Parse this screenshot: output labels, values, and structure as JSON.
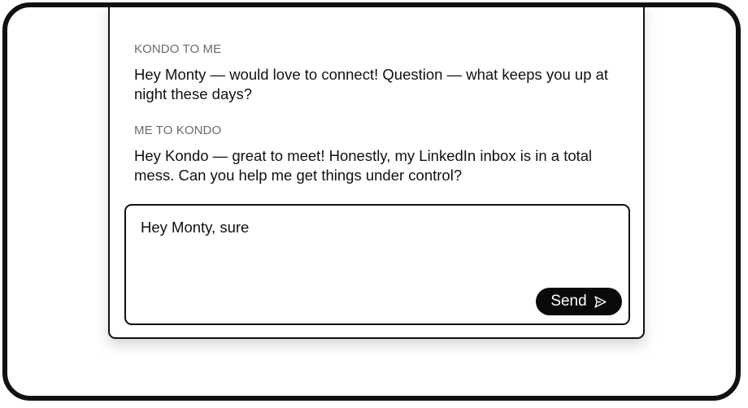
{
  "conversation": {
    "messages": [
      {
        "sender": "KONDO TO ME",
        "text": "Hey Monty — would love to connect! Question — what keeps you up at night these days?"
      },
      {
        "sender": "ME TO KONDO",
        "text": "Hey Kondo — great to meet! Honestly, my LinkedIn inbox is in a total mess. Can you help me get things under control?"
      }
    ]
  },
  "composer": {
    "draft": "Hey Monty, sure",
    "send_label": "Send",
    "send_icon": "send-icon"
  }
}
